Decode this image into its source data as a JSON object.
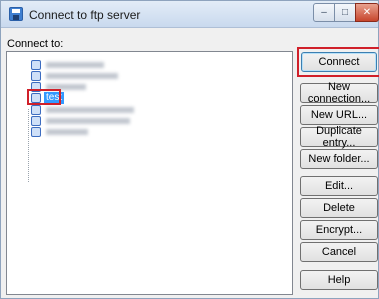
{
  "window": {
    "title": "Connect to ftp server"
  },
  "connect_to_label": "Connect to:",
  "tree": {
    "selected_item": "test"
  },
  "buttons": {
    "connect": "Connect",
    "new_connection": "New connection...",
    "new_url": "New URL...",
    "duplicate_entry": "Duplicate entry...",
    "new_folder": "New folder...",
    "edit": "Edit...",
    "delete": "Delete",
    "encrypt": "Encrypt...",
    "cancel": "Cancel",
    "help": "Help"
  },
  "titlebar_controls": {
    "minimize": "–",
    "maximize": "□",
    "close": "✕"
  }
}
